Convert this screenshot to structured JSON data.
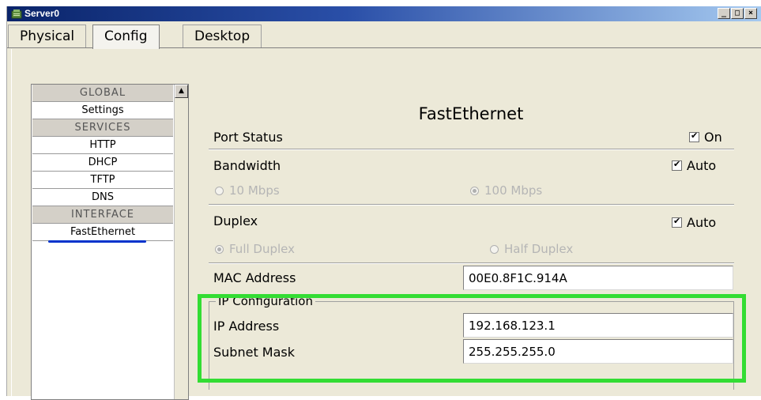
{
  "window": {
    "title": "Server0",
    "controls": {
      "minimize": "_",
      "maximize": "□",
      "close": "×"
    }
  },
  "tabs": [
    {
      "label": "Physical",
      "active": false
    },
    {
      "label": "Config",
      "active": true
    },
    {
      "label": "Desktop",
      "active": false
    }
  ],
  "sidebar": {
    "items": [
      {
        "label": "GLOBAL",
        "kind": "header"
      },
      {
        "label": "Settings",
        "kind": "link"
      },
      {
        "label": "SERVICES",
        "kind": "header"
      },
      {
        "label": "HTTP",
        "kind": "link"
      },
      {
        "label": "DHCP",
        "kind": "link"
      },
      {
        "label": "TFTP",
        "kind": "link"
      },
      {
        "label": "DNS",
        "kind": "link"
      },
      {
        "label": "INTERFACE",
        "kind": "header"
      },
      {
        "label": "FastEthernet",
        "kind": "link",
        "selected": true
      }
    ],
    "scroll_up_glyph": "▲"
  },
  "panel": {
    "title": "FastEthernet",
    "port_status": {
      "label": "Port Status",
      "checkbox_label": "On",
      "checked": true
    },
    "bandwidth": {
      "label": "Bandwidth",
      "checkbox_label": "Auto",
      "checked": true,
      "options": [
        {
          "label": "10 Mbps",
          "selected": false
        },
        {
          "label": "100 Mbps",
          "selected": true
        }
      ]
    },
    "duplex": {
      "label": "Duplex",
      "checkbox_label": "Auto",
      "checked": true,
      "options": [
        {
          "label": "Full Duplex",
          "selected": true
        },
        {
          "label": "Half Duplex",
          "selected": false
        }
      ]
    },
    "mac_address": {
      "label": "MAC Address",
      "value": "00E0.8F1C.914A"
    },
    "ip_config": {
      "legend": "IP Configuration",
      "ip_address": {
        "label": "IP Address",
        "value": "192.168.123.1"
      },
      "subnet_mask": {
        "label": "Subnet Mask",
        "value": "255.255.255.0"
      }
    }
  },
  "colors": {
    "highlight": "#33dd33",
    "title_bar": "#0a246a",
    "selection_underline": "#0033cc"
  }
}
